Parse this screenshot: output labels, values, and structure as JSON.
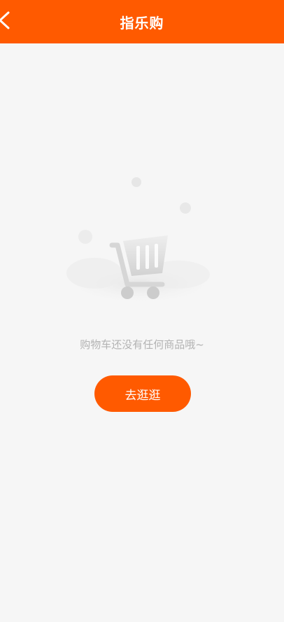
{
  "header": {
    "title": "指乐购",
    "back_icon": "chevron-left-icon"
  },
  "empty_state": {
    "illustration_icon": "shopping-cart-icon",
    "message": "购物车还没有任何商品哦~",
    "button_label": "去逛逛"
  },
  "colors": {
    "brand": "#ff5a00",
    "background": "#f6f6f6",
    "message_text": "#b3b3b3"
  }
}
